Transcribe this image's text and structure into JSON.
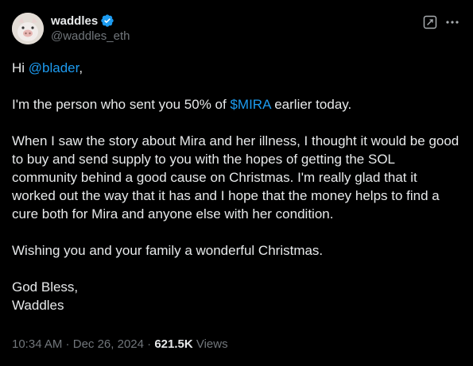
{
  "author": {
    "display_name": "waddles",
    "handle": "@waddles_eth",
    "verified": true,
    "avatar_icon": "avatar-cartoon-pig"
  },
  "actions": {
    "grok_icon": "grok-icon",
    "more_icon": "more-icon"
  },
  "tweet": {
    "greeting_prefix": "Hi ",
    "mention": "@blader",
    "greeting_suffix": ",",
    "p1_prefix": "I'm the person who sent you 50% of ",
    "p1_cashtag": "$MIRA",
    "p1_suffix": " earlier today.",
    "p2": "When I saw the story about Mira and her illness, I thought it would be good to buy and send supply to you with the hopes of getting the SOL community behind a good cause on Christmas. I'm really glad that it worked out the way that it has and I hope that the money helps to find a cure both for Mira and anyone else with her condition.",
    "p3": "Wishing you and your family a wonderful Christmas.",
    "signoff_line1": "God Bless,",
    "signoff_line2": "Waddles"
  },
  "meta": {
    "time": "10:34 AM",
    "separator": " · ",
    "date": "Dec 26, 2024",
    "views_count": "621.5K",
    "views_label": " Views"
  },
  "colors": {
    "background": "#000000",
    "text": "#e7e9ea",
    "secondary": "#71767b",
    "link": "#1d9bf0"
  }
}
